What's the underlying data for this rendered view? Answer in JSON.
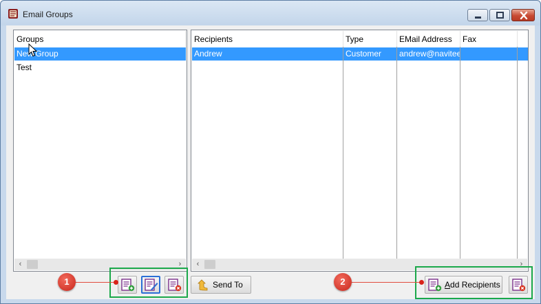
{
  "window": {
    "title": "Email Groups",
    "colors": {
      "selection": "#3399ff",
      "highlight_box": "#1aa84a",
      "callout": "#d8231a"
    }
  },
  "groups_panel": {
    "header": "Groups",
    "items": [
      {
        "label": "New Group",
        "selected": true
      },
      {
        "label": "Test",
        "selected": false
      }
    ]
  },
  "recipients_panel": {
    "columns": [
      "Recipients",
      "Type",
      "EMail Address",
      "Fax"
    ],
    "rows": [
      {
        "recipient": "Andrew",
        "type": "Customer",
        "email": "andrew@naviteer.c",
        "fax": "",
        "selected": true
      }
    ]
  },
  "toolbar": {
    "add_group_icon": "add-group-icon",
    "edit_group_icon": "edit-group-icon",
    "delete_group_icon": "delete-group-icon",
    "send_to_label": "Send To",
    "add_recipients_prefix": "A",
    "add_recipients_rest": "dd Recipients",
    "delete_recipient_icon": "delete-recipient-icon"
  },
  "callouts": {
    "one": "1",
    "two": "2"
  }
}
